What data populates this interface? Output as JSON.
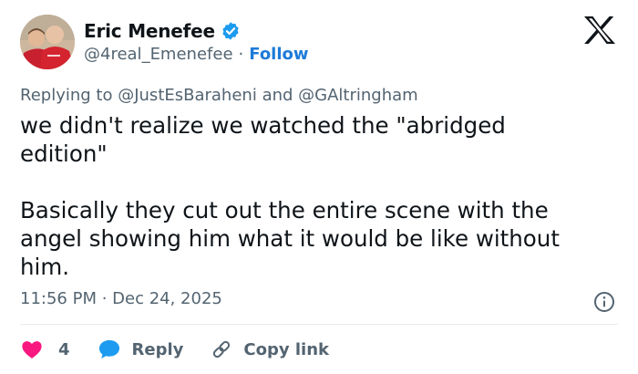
{
  "author": {
    "name": "Eric Menefee",
    "handle": "@4real_Emenefee",
    "separator": "·",
    "follow_label": "Follow"
  },
  "reply": {
    "prefix": "Replying to",
    "mention_1": "@JustEsBaraheni",
    "conjunction": "and",
    "mention_2": "@GAltringham"
  },
  "tweet": {
    "text": "we didn't realize we watched the \"abridged\nedition\"\n\nBasically they cut out the entire scene with the\nangel showing him what it would be like without\nhim.",
    "timestamp": "11:56 PM · Dec 24, 2025"
  },
  "actions": {
    "like_count": "4",
    "reply_label": "Reply",
    "copy_label": "Copy link"
  },
  "icons": {
    "logo": "x-logo-icon",
    "verified": "verified-badge-icon",
    "info": "info-icon",
    "like": "heart-icon",
    "reply": "reply-bubble-icon",
    "copy": "link-icon"
  },
  "colors": {
    "accent": "#1d7bd8",
    "verified": "#1d9bf0",
    "like": "#f91880",
    "muted": "#536471",
    "text": "#0f1419"
  }
}
